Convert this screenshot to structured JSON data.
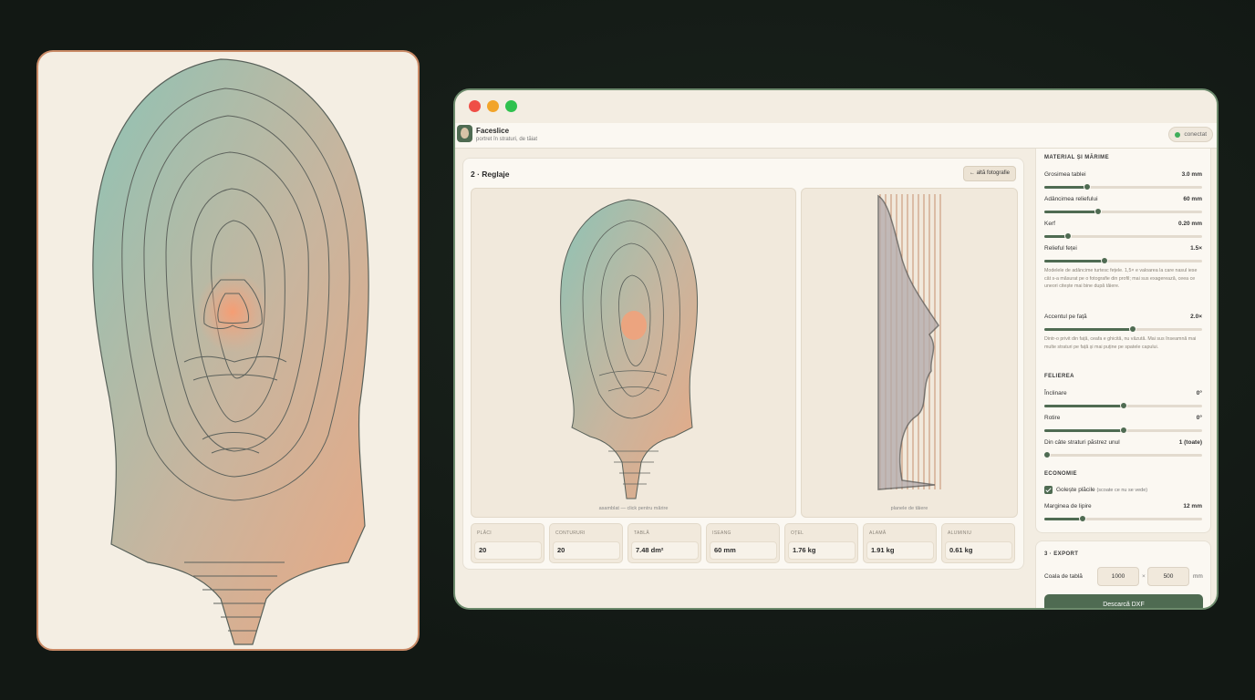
{
  "app": {
    "title": "Faceslice",
    "subtitle": "portret în straturi, de tăiat",
    "status": "conectat"
  },
  "step2": {
    "title": "2 · Reglaje",
    "back_button": "← altă fotografie",
    "viewer_left_caption": "asamblat — click pentru mărire",
    "viewer_right_caption": "planele de tăiere"
  },
  "stats": [
    {
      "label": "PLĂCI",
      "value": "20"
    },
    {
      "label": "CONTURURI",
      "value": "20"
    },
    {
      "label": "TABLĂ",
      "value": "7.48 dm²"
    },
    {
      "label": "ISEANG",
      "value": "60 mm"
    },
    {
      "label": "OȚEL",
      "value": "1.76 kg"
    },
    {
      "label": "ALAMĂ",
      "value": "1.91 kg"
    },
    {
      "label": "ALUMINIU",
      "value": "0.61 kg"
    }
  ],
  "settings": {
    "material_heading": "MATERIAL ȘI MĂRIME",
    "sliders": [
      {
        "label": "Grosimea tablei",
        "value": "3.0 mm",
        "level": 0.27
      },
      {
        "label": "Adâncimea reliefului",
        "value": "60 mm",
        "level": 0.34
      },
      {
        "label": "Kerf",
        "value": "0.20 mm",
        "level": 0.15
      },
      {
        "label": "Relieful feței",
        "value": "1.5×",
        "level": 0.38
      }
    ],
    "relief_help": "Modelele de adâncime turtesc fețele. 1,5× e valoarea la care nasul iese cât s-a măsurat pe o fotografie din profil; mai sus exagerează, ceea ce uneori citește mai bine după tăiere.",
    "accent": {
      "label": "Accentul pe față",
      "value": "2.0×",
      "level": 0.56
    },
    "accent_help": "Dintr-o privit din față, ceafa e ghicită, nu văzută. Mai sus înseamnă mai multe straturi pe față și mai puține pe spatele capului.",
    "slicing_heading": "FELIEREA",
    "slicing": [
      {
        "label": "Înclinare",
        "value": "0°",
        "level": 0.5
      },
      {
        "label": "Rotire",
        "value": "0°",
        "level": 0.5
      },
      {
        "label": "Din câte straturi păstrez unul",
        "value": "1 (toate)",
        "level": 0.02
      }
    ],
    "economy_heading": "ECONOMIE",
    "hollow_label": "Golește plăcile",
    "hollow_note": "(scoate ce nu se vede)",
    "margin": {
      "label": "Marginea de lipire",
      "value": "12 mm",
      "level": 0.24
    }
  },
  "export": {
    "heading": "3 · EXPORT",
    "sheet_label": "Coala de tablă",
    "width": "1000",
    "times": "×",
    "height": "500",
    "unit": "mm",
    "download": "Descarcă DXF"
  },
  "colors": {
    "accent": "#4f6b52",
    "teal": "#8fc2b4",
    "orange": "#f0a07a"
  }
}
